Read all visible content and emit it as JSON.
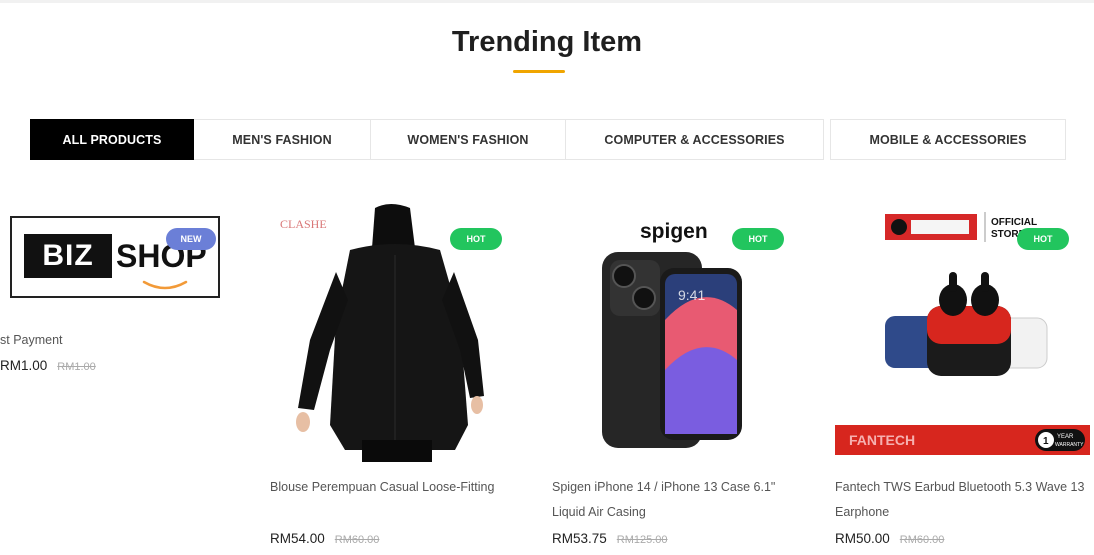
{
  "section": {
    "title": "Trending Item",
    "accent": "#f0a500"
  },
  "tabs": [
    {
      "label": "ALL PRODUCTS",
      "active": true
    },
    {
      "label": "MEN'S FASHION",
      "active": false
    },
    {
      "label": "WOMEN'S FASHION",
      "active": false
    },
    {
      "label": "COMPUTER & ACCESSORIES",
      "active": false
    },
    {
      "label": "MOBILE & ACCESSORIES",
      "active": false
    }
  ],
  "products": [
    {
      "name": "st Payment",
      "price": "RM1.00",
      "old_price": "RM1.00",
      "badge": "NEW",
      "logo_left": "BIZ",
      "logo_right": "SHOP"
    },
    {
      "name": "Blouse Perempuan Casual Loose-Fitting",
      "price": "RM54.00",
      "old_price": "RM60.00",
      "badge": "HOT",
      "brand": "CLASHE"
    },
    {
      "name": "Spigen iPhone 14 / iPhone 13 Case 6.1\" Liquid Air Casing",
      "price": "RM53.75",
      "old_price": "RM125.00",
      "badge": "HOT",
      "brand": "spigen"
    },
    {
      "name": "Fantech TWS Earbud Bluetooth 5.3 Wave 13 Earphone",
      "price": "RM50.00",
      "old_price": "RM60.00",
      "badge": "HOT",
      "brand": "FANTECH",
      "store_text": "OFFICIAL STORE",
      "warranty_text": "1 YEAR WARRANTY"
    }
  ],
  "colors": {
    "hot_badge": "#22c55e",
    "new_badge": "#6b7fd7",
    "active_tab": "#000000"
  }
}
